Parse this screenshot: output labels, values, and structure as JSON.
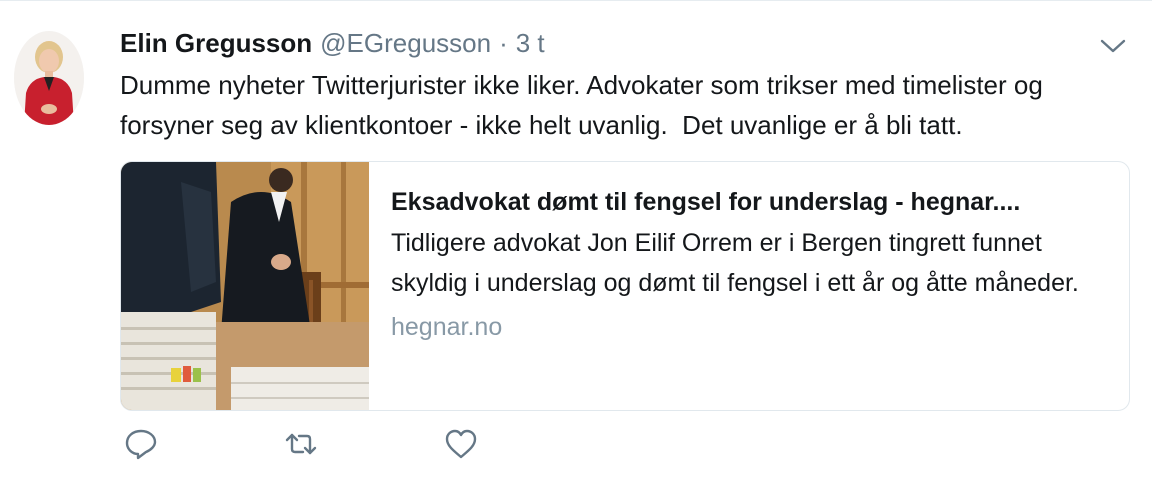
{
  "tweet": {
    "author_name": "Elin Gregusson",
    "handle": "@EGregusson",
    "separator": "·",
    "time": "3 t",
    "text": "Dumme nyheter Twitterjurister ikke liker. Advokater som trikser med timelister og forsyner seg av klientkontoer - ikke helt uvanlig.  Det uvanlige er å bli tatt."
  },
  "card": {
    "title": "Eksadvokat dømt til fengsel for underslag - hegnar....",
    "description": "Tidligere advokat Jon Eilif Orrem er i Bergen tingrett funnet skyldig i underslag og dømt til fengsel i ett år og åtte måneder.",
    "domain": "hegnar.no"
  },
  "icons": {
    "menu": "chevron-down-icon",
    "reply": "reply-icon",
    "retweet": "retweet-icon",
    "like": "heart-icon"
  },
  "colors": {
    "text": "#14171a",
    "secondary": "#657786",
    "domain": "#8899a6",
    "border": "#e1e8ed"
  }
}
